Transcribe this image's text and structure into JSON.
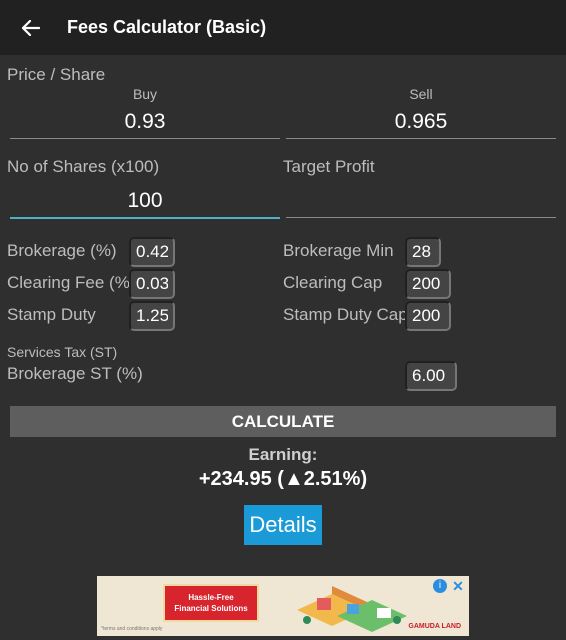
{
  "appbar": {
    "title": "Fees Calculator (Basic)"
  },
  "price": {
    "section_label": "Price / Share",
    "buy_label": "Buy",
    "sell_label": "Sell",
    "buy_value": "0.93",
    "sell_value": "0.965"
  },
  "shares": {
    "label": "No of Shares (x100)",
    "value": "100"
  },
  "target": {
    "label": "Target Profit",
    "value": ""
  },
  "fees_left": [
    {
      "label": "Brokerage (%)",
      "value": "0.42"
    },
    {
      "label": "Clearing Fee (%)",
      "value": "0.03"
    },
    {
      "label": "Stamp Duty",
      "value": "1.25"
    }
  ],
  "fees_right": [
    {
      "label": "Brokerage Min",
      "value": "28"
    },
    {
      "label": "Clearing Cap",
      "value": "200"
    },
    {
      "label": "Stamp Duty Cap",
      "value": "200"
    }
  ],
  "services_tax": {
    "heading": "Services Tax (ST)",
    "label": "Brokerage ST (%)",
    "value": "6.00"
  },
  "calculate_label": "CALCULATE",
  "earning": {
    "label": "Earning:",
    "value": "+234.95 (▲2.51%)"
  },
  "details_label": "Details",
  "ad": {
    "headline_1": "Hassle-Free",
    "headline_2": "Financial Solutions",
    "brand": "GAMUDA LAND",
    "fine_print": "*terms and conditions apply"
  },
  "colors": {
    "accent": "#1a9bd7",
    "focus_underline": "#4fb0c6",
    "background": "#2f2f2f"
  }
}
